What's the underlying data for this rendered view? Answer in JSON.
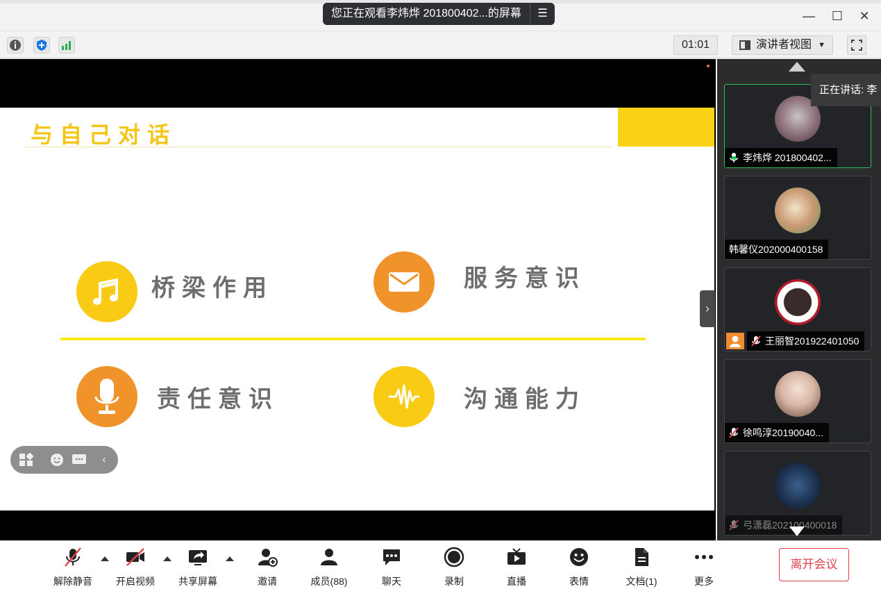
{
  "titlebar": {
    "screen_share_banner": "您正在观看李炜烨 201800402...的屏幕",
    "banner_menu_icon": "menu-lines-icon",
    "minimize_icon": "minimize-icon",
    "maximize_icon": "maximize-icon",
    "close_icon": "close-icon"
  },
  "toolrow": {
    "icons": [
      "info-icon",
      "shield-icon",
      "signal-bars-icon"
    ],
    "timer": "01:01",
    "view_selector": "演讲者视图",
    "fullscreen_icon": "fullscreen-icon"
  },
  "slide": {
    "title": "与自己对话",
    "items": [
      {
        "label": "桥梁作用",
        "icon": "music-note-icon",
        "color": "#f9cb14"
      },
      {
        "label": "服务意识",
        "icon": "envelope-icon",
        "color": "#f0932a"
      },
      {
        "label": "责任意识",
        "icon": "microphone-icon",
        "color": "#f0932a"
      },
      {
        "label": "沟通能力",
        "icon": "sound-wave-icon",
        "color": "#f9cb14"
      }
    ],
    "accent_colors": {
      "yellow": "#fcd215",
      "divider": "#fbe91a",
      "orange": "#f0932a"
    }
  },
  "floating_toolbar": {
    "icons": [
      "apps-icon",
      "emoji-icon",
      "chat-bubble-icon",
      "collapse-left-icon"
    ]
  },
  "sidebar": {
    "speaking_tooltip": "正在讲话: 李",
    "participants": [
      {
        "name": "李炜烨 201800402...",
        "mic": "active",
        "active_speaker": true
      },
      {
        "name": "韩馨仪202000400158",
        "mic": "none",
        "active_speaker": false
      },
      {
        "name": "王丽智201922401050",
        "mic": "muted",
        "active_speaker": false,
        "badge": "host-avatar-icon"
      },
      {
        "name": "徐鸣淳20190040...",
        "mic": "muted",
        "active_speaker": false
      },
      {
        "name": "弓潇磊202100400018",
        "mic": "muted",
        "active_speaker": false
      }
    ]
  },
  "bottombar": {
    "items": [
      {
        "label": "解除静音",
        "icon": "mic-muted-icon"
      },
      {
        "label": "开启视频",
        "icon": "video-off-icon"
      },
      {
        "label": "共享屏幕",
        "icon": "share-screen-icon"
      },
      {
        "label": "邀请",
        "icon": "invite-user-icon"
      },
      {
        "label": "成员(88)",
        "icon": "members-icon"
      },
      {
        "label": "聊天",
        "icon": "chat-icon"
      },
      {
        "label": "录制",
        "icon": "record-icon"
      },
      {
        "label": "直播",
        "icon": "live-icon"
      },
      {
        "label": "表情",
        "icon": "emoji-icon"
      },
      {
        "label": "文档(1)",
        "icon": "document-icon"
      },
      {
        "label": "更多",
        "icon": "more-icon"
      }
    ],
    "leave_button": "离开会议",
    "leave_color": "#e0424e"
  }
}
